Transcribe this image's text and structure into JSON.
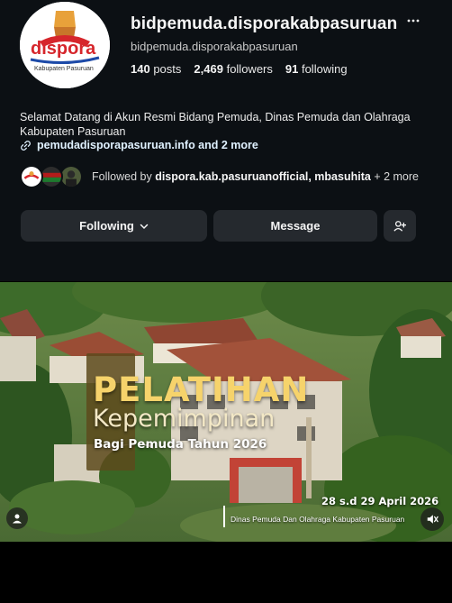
{
  "profile": {
    "username": "bidpemuda.disporakabpasuruan",
    "handle": "bidpemuda.disporakabpasuruan",
    "stats": {
      "posts_count": "140",
      "posts_label": "posts",
      "followers_count": "2,469",
      "followers_label": "followers",
      "following_count": "91",
      "following_label": "following"
    },
    "bio": "Selamat Datang di Akun Resmi Bidang Pemuda, Dinas Pemuda dan Olahraga Kabupaten Pasuruan",
    "link": "pemudadisporapasuruan.info and 2 more",
    "followed_by": {
      "prefix": "Followed by",
      "names": "dispora.kab.pasuruanofficial, mbasuhita",
      "suffix": "+ 2 more"
    },
    "avatar_logo_text": "dispora",
    "avatar_logo_subtext": "Kabupaten Pasuruan"
  },
  "actions": {
    "following_label": "Following",
    "message_label": "Message"
  },
  "reel": {
    "title_line1": "PELATIHAN",
    "title_line2": "Kepemimpinan",
    "title_line3": "Bagi Pemuda Tahun 2026",
    "date": "28 s.d 29 April 2026",
    "organizer": "Dinas Pemuda Dan Olahraga Kabupaten Pasuruan"
  },
  "icons": {
    "more": "more-horizontal-icon",
    "link": "link-icon",
    "chevron": "chevron-down-icon",
    "add_user": "add-user-icon",
    "user": "user-icon",
    "mute": "speaker-muted-icon"
  },
  "colors": {
    "background": "#0c1014",
    "button": "#25292e",
    "title_gold": "#f6d36b",
    "brand_red": "#d6262c"
  }
}
